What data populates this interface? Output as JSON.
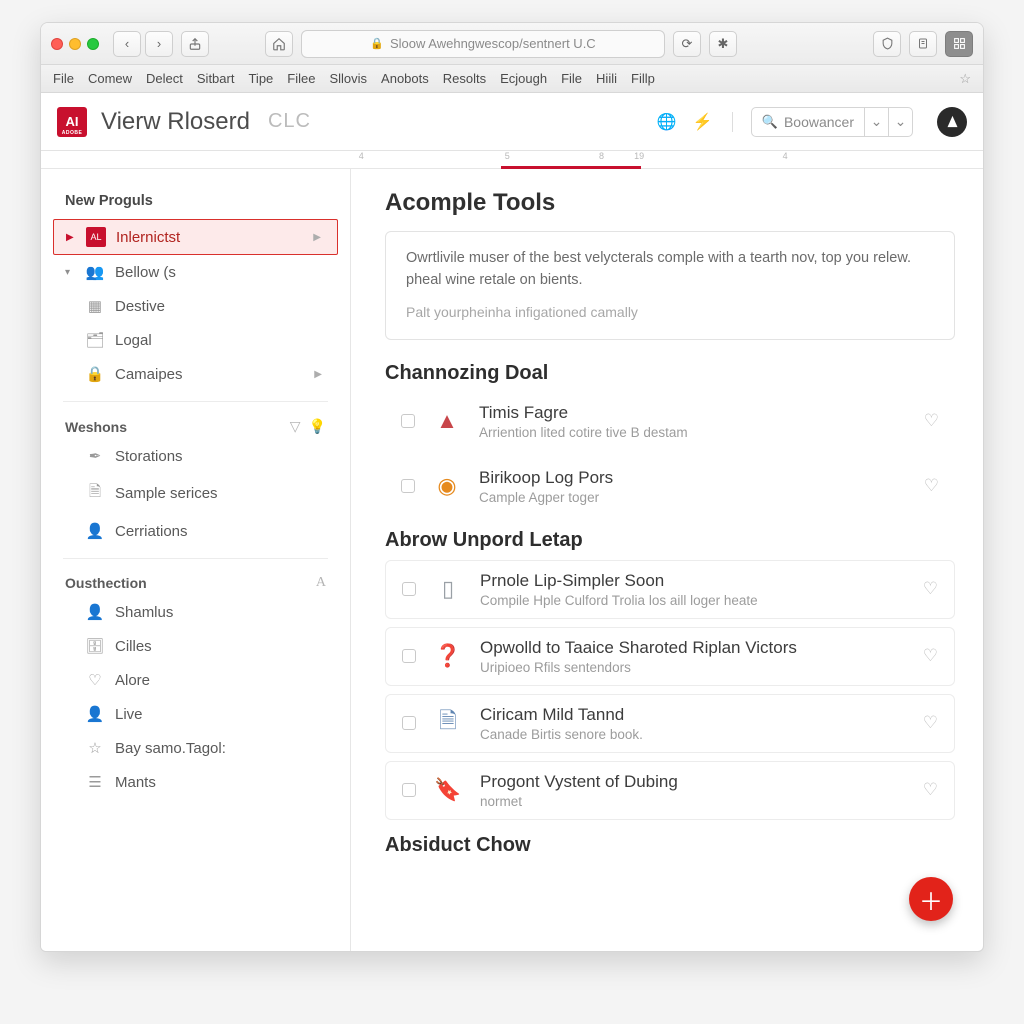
{
  "browser": {
    "address": "Sloow Awehngwescop/sentnert U.C",
    "menus": [
      "File",
      "Comew",
      "Delect",
      "Sitbart",
      "Tipe",
      "Filee",
      "Sllovis",
      "Anobots",
      "Resolts",
      "Ecjough",
      "File",
      "Hiili",
      "Fillp"
    ]
  },
  "header": {
    "title": "Vierw Rloserd",
    "subtitle": "CLC",
    "search_label": "Boowancer"
  },
  "ruler": {
    "marks": [
      "",
      "",
      "4",
      "",
      "5",
      "8",
      "19",
      "",
      "4",
      ""
    ]
  },
  "sidebar": {
    "section_new": "New Proguls",
    "item_selected": "Inlernictst",
    "item_bellow": "Bellow (s",
    "item_destive": "Destive",
    "item_logal": "Logal",
    "item_camaipes": "Camaipes",
    "section_weshons": "Weshons",
    "item_storations": "Storations",
    "item_sample": "Sample serices",
    "item_cerrations": "Cerriations",
    "section_ousthection": "Ousthection",
    "item_shamus": "Shamlus",
    "item_cilles": "Cilles",
    "item_alore": "Alore",
    "item_live": "Live",
    "item_baysamo": "Bay samo.Tagol:",
    "item_mants": "Mants"
  },
  "main": {
    "title": "Acomple Tools",
    "intro1": "Owrtlivile muser of the best velycterals comple with a tearth nov, top you relew. pheal wine retale on bients.",
    "intro2": "Palt yourpheinha infigationed camally",
    "h_channozing": "Channozing Doal",
    "items1": [
      {
        "title": "Timis Fagre",
        "desc": "Arriention lited cotire tive B destam"
      },
      {
        "title": "Birikoop Log Pors",
        "desc": "Cample Agper toger"
      }
    ],
    "h_abrow": "Abrow Unpord Letap",
    "items2": [
      {
        "title": "Prnole Lip-Simpler Soon",
        "desc": "Compile Hple Culford Trolia los aill loger heate"
      },
      {
        "title": "Opwolld to Taaice Sharoted Riplan Victors",
        "desc": "Uripioeo Rfils sentendors"
      },
      {
        "title": "Ciricam Mild Tannd",
        "desc": "Canade Birtis senore book."
      },
      {
        "title": "Progont Vystent of Dubing",
        "desc": "normet"
      }
    ],
    "h_absiduct": "Absiduct Chow"
  }
}
